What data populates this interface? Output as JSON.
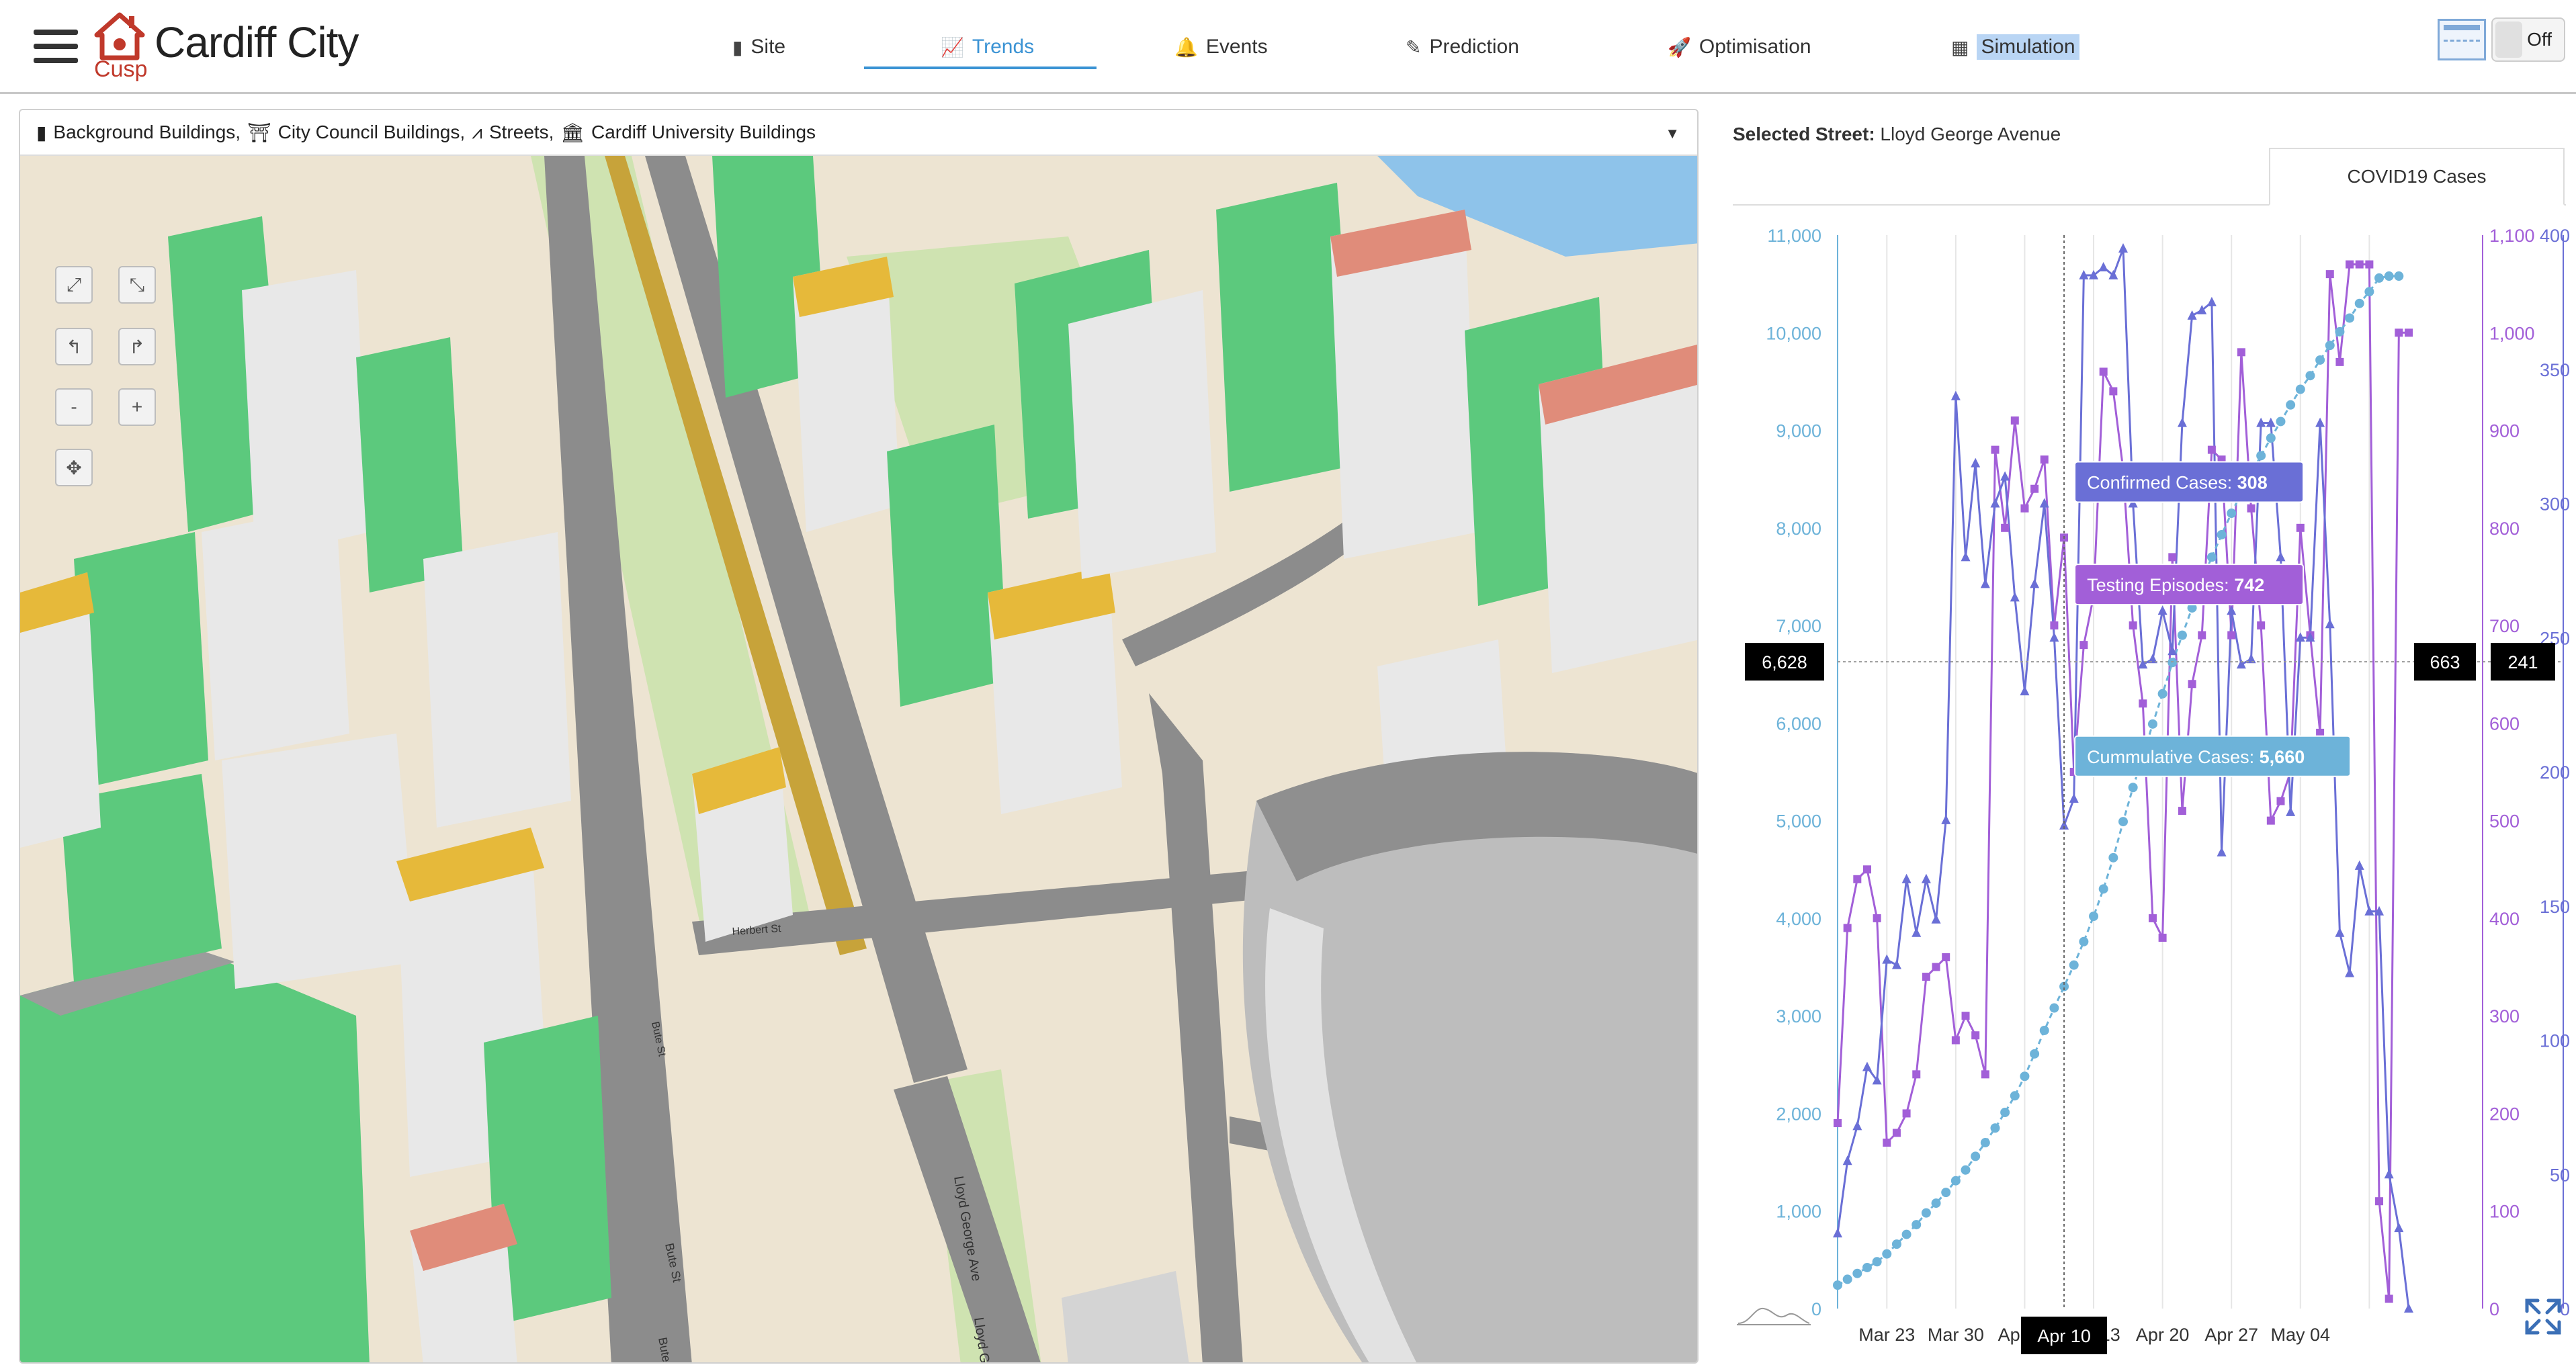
{
  "header": {
    "brand_title": "Cardiff City",
    "logo_sub": "Cusp",
    "nav": [
      {
        "label": "Site",
        "icon": "building-icon"
      },
      {
        "label": "Trends",
        "icon": "trend-chart-icon",
        "active": true
      },
      {
        "label": "Events",
        "icon": "bell-icon"
      },
      {
        "label": "Prediction",
        "icon": "magic-wand-icon"
      },
      {
        "label": "Optimisation",
        "icon": "rocket-icon"
      },
      {
        "label": "Simulation",
        "icon": "calculator-icon",
        "highlighted": true
      }
    ],
    "toggle_label": "Off"
  },
  "layers": {
    "items": [
      {
        "label": "Background Buildings,",
        "icon": "building-icon"
      },
      {
        "label": "City Council Buildings,",
        "icon": "gate-icon"
      },
      {
        "label": "Streets,",
        "icon": "road-icon"
      },
      {
        "label": "Cardiff University Buildings",
        "icon": "university-icon"
      }
    ]
  },
  "map": {
    "controls": [
      "⤢",
      "⤡",
      "↰",
      "↱",
      "-",
      "+",
      "✥"
    ],
    "street_labels": [
      "Lloyd George Ave",
      "Lloyd George Ave",
      "Bute St",
      "Bute St",
      "Herbert St",
      "Bute St"
    ]
  },
  "panel": {
    "selected_label": "Selected Street:",
    "selected_value": "Lloyd George Avenue",
    "tab_label": "COVID19 Cases"
  },
  "colors": {
    "accent": "#3b93d4",
    "cumulative": "#6db3d9",
    "confirmed": "#6a6fd6",
    "testing": "#a25fd8",
    "building_green": "#5cc97d",
    "building_grey": "#e7e7e7",
    "building_yellow": "#e6b93a",
    "road": "#8c8c8c",
    "map_bg": "#ede4d2"
  },
  "chart_data": {
    "type": "line",
    "x_tick_labels": [
      "Mar 23",
      "Mar 30",
      "Apr 06",
      "Apr 13",
      "Apr 20",
      "Apr 27",
      "May 04"
    ],
    "y_axis_left": {
      "ticks": [
        "0",
        "1,000",
        "2,000",
        "3,000",
        "4,000",
        "5,000",
        "6,000",
        "7,000",
        "8,000",
        "9,000",
        "10,000",
        "11,000"
      ],
      "range": [
        0,
        11000
      ]
    },
    "y_axis_right1": {
      "ticks": [
        "0",
        "100",
        "200",
        "300",
        "400",
        "500",
        "600",
        "700",
        "800",
        "900",
        "1,000",
        "1,100"
      ],
      "range": [
        0,
        1100
      ]
    },
    "y_axis_right2": {
      "ticks": [
        "0",
        "50",
        "100",
        "150",
        "200",
        "250",
        "300",
        "350",
        "400"
      ],
      "range": [
        0,
        400
      ]
    },
    "x_start_date": "Mar 18",
    "series": [
      {
        "name": "Cummulative Cases",
        "axis": "left",
        "marker": "circle",
        "values": [
          240,
          300,
          360,
          420,
          480,
          560,
          660,
          760,
          860,
          980,
          1080,
          1190,
          1310,
          1420,
          1560,
          1700,
          1850,
          2010,
          2180,
          2380,
          2610,
          2850,
          3080,
          3300,
          3520,
          3760,
          4020,
          4300,
          4620,
          4990,
          5340,
          5660,
          5990,
          6300,
          6620,
          6900,
          7180,
          7460,
          7700,
          7930,
          8150,
          8360,
          8560,
          8740,
          8920,
          9090,
          9260,
          9420,
          9560,
          9720,
          9870,
          10010,
          10150,
          10300,
          10420,
          10560,
          10580,
          10580
        ]
      },
      {
        "name": "Confirmed Cases",
        "axis": "right2",
        "marker": "triangle",
        "values": [
          28,
          55,
          68,
          90,
          85,
          130,
          128,
          160,
          140,
          160,
          145,
          182,
          340,
          280,
          315,
          270,
          300,
          310,
          265,
          230,
          270,
          300,
          250,
          180,
          190,
          385,
          385,
          388,
          385,
          395,
          300,
          240,
          242,
          260,
          245,
          330,
          370,
          372,
          375,
          170,
          260,
          240,
          242,
          330,
          330,
          280,
          185,
          250,
          250,
          330,
          255,
          140,
          125,
          165,
          148,
          148,
          50,
          30,
          0
        ]
      },
      {
        "name": "Testing Episodes",
        "axis": "right1",
        "marker": "square",
        "values": [
          190,
          390,
          440,
          450,
          400,
          170,
          180,
          200,
          240,
          340,
          350,
          360,
          275,
          300,
          280,
          240,
          880,
          800,
          910,
          820,
          840,
          870,
          700,
          790,
          550,
          680,
          730,
          960,
          940,
          860,
          700,
          620,
          400,
          380,
          770,
          510,
          640,
          690,
          880,
          870,
          690,
          980,
          820,
          700,
          500,
          520,
          550,
          800,
          690,
          590,
          1060,
          970,
          1070,
          1070,
          1070,
          110,
          10,
          1000,
          1000
        ]
      }
    ],
    "tooltips": [
      {
        "label": "Confirmed Cases:",
        "value": "308"
      },
      {
        "label": "Testing Episodes:",
        "value": "742"
      },
      {
        "label": "Cummulative Cases:",
        "value": "5,660"
      }
    ],
    "crosshair": {
      "x_label": "Apr 10",
      "left_value": "6,628",
      "right1_value": "663",
      "right2_value": "241"
    },
    "legend": [
      "Cummulative Cases",
      "Confirmed Cases",
      "Testing Episodes"
    ]
  }
}
